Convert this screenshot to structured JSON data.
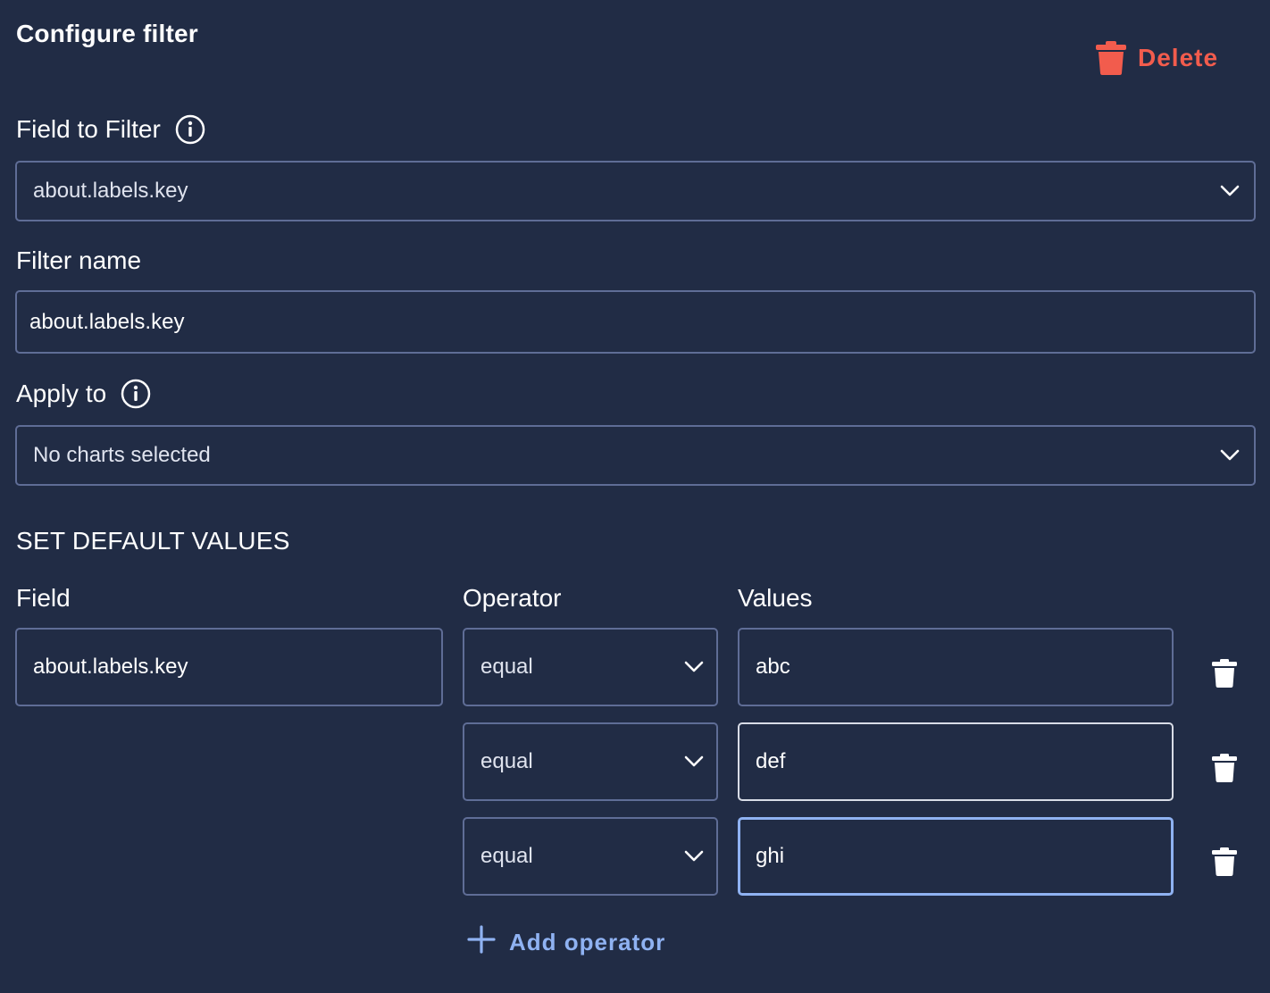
{
  "header": {
    "title": "Configure filter",
    "delete_label": "Delete"
  },
  "field_to_filter": {
    "label": "Field to Filter",
    "selected": "about.labels.key"
  },
  "filter_name": {
    "label": "Filter name",
    "value": "about.labels.key"
  },
  "apply_to": {
    "label": "Apply to",
    "selected": "No charts selected"
  },
  "defaults": {
    "section_title": "SET DEFAULT VALUES",
    "columns": {
      "field": "Field",
      "operator": "Operator",
      "values": "Values"
    },
    "field_value": "about.labels.key",
    "rows": [
      {
        "operator": "equal",
        "value": "abc"
      },
      {
        "operator": "equal",
        "value": "def"
      },
      {
        "operator": "equal",
        "value": "ghi"
      }
    ],
    "add_operator_label": "Add operator"
  },
  "colors": {
    "background": "#212c45",
    "border": "#5f6d96",
    "delete": "#f25c4d",
    "accent": "#8fb2f2"
  },
  "icons": {
    "delete": "trash-icon",
    "info": "info-icon",
    "dropdown": "chevron-down-icon",
    "add": "plus-icon"
  }
}
